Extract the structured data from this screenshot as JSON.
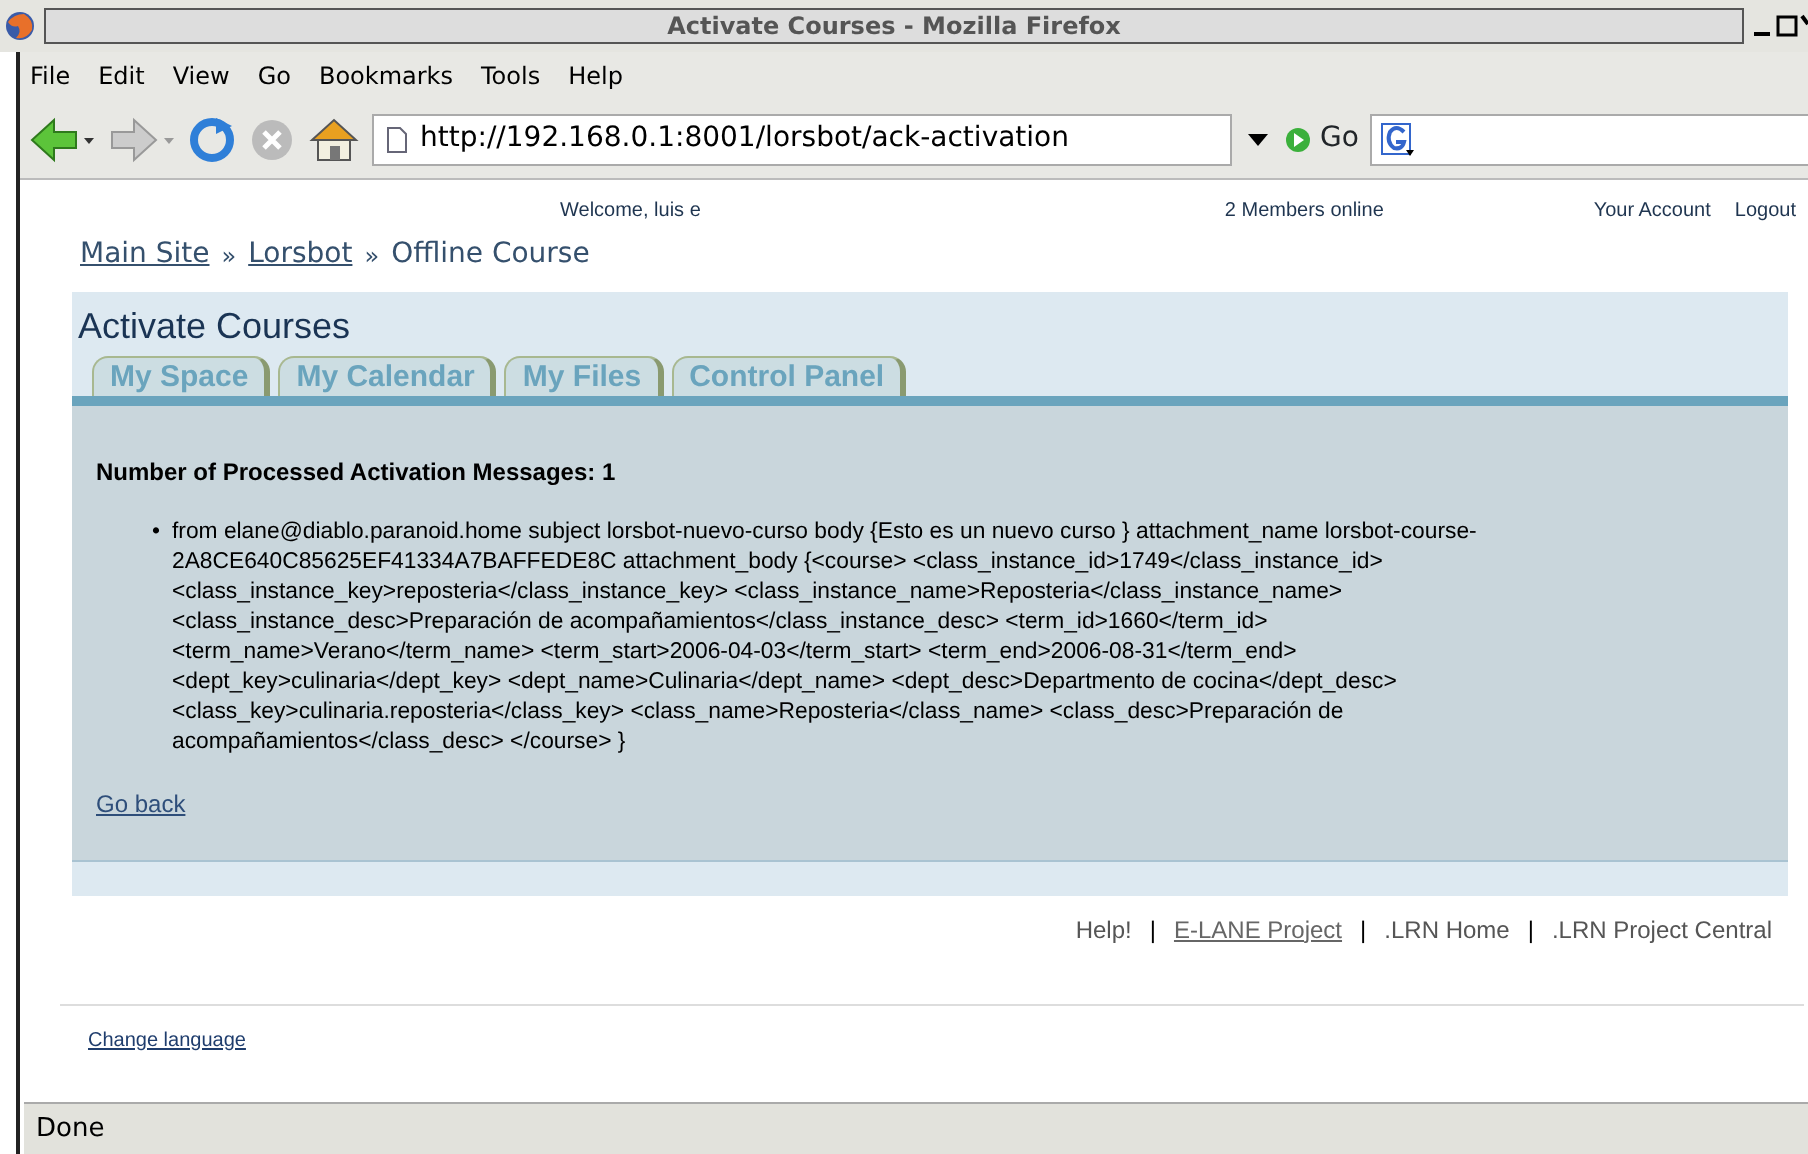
{
  "window": {
    "title": "Activate Courses - Mozilla Firefox"
  },
  "menu": [
    "File",
    "Edit",
    "View",
    "Go",
    "Bookmarks",
    "Tools",
    "Help"
  ],
  "toolbar": {
    "url": "http://192.168.0.1:8001/lorsbot/ack-activation",
    "go": "Go"
  },
  "header": {
    "welcome": "Welcome, luis e",
    "online": "2 Members online",
    "links": [
      "Your Account",
      "Logout"
    ]
  },
  "breadcrumb": [
    {
      "text": "Main Site",
      "kind": "link"
    },
    {
      "text": "»",
      "kind": "sep"
    },
    {
      "text": "Lorsbot",
      "kind": "link"
    },
    {
      "text": "»",
      "kind": "sep"
    },
    {
      "text": "Offline Course",
      "kind": "current"
    }
  ],
  "page_title": "Activate Courses",
  "tabs": [
    {
      "label": "My Space",
      "selected": false
    },
    {
      "label": "My Calendar",
      "selected": false
    },
    {
      "label": "My Files",
      "selected": false
    },
    {
      "label": "Control Panel",
      "selected": false
    }
  ],
  "heading": "Number of Processed Activation Messages: 1",
  "messages": [
    {
      "bullet": "•",
      "text": "from elane@diablo.paranoid.home subject lorsbot-nuevo-curso body {Esto es un nuevo curso } attachment_name lorsbot-course-2A8CE640C85625EF41334A7BAFFEDE8C attachment_body {<course> <class_instance_id>1749</class_instance_id> <class_instance_key>reposteria</class_instance_key> <class_instance_name>Reposteria</class_instance_name> <class_instance_desc>Preparación de acompañamientos</class_instance_desc> <term_id>1660</term_id> <term_name>Verano</term_name> <term_start>2006-04-03</term_start> <term_end>2006-08-31</term_end> <dept_key>culinaria</dept_key> <dept_name>Culinaria</dept_name> <dept_desc>Departmento de cocina</dept_desc> <class_key>culinaria.reposteria</class_key> <class_name>Reposteria</class_name> <class_desc>Preparación de acompañamientos</class_desc> </course> }"
    }
  ],
  "back_link": "Go back",
  "footer": [
    {
      "text": "Help!",
      "kind": "plain"
    },
    {
      "text": "|",
      "kind": "sep"
    },
    {
      "text": "E-LANE Project",
      "kind": "link"
    },
    {
      "text": "|",
      "kind": "sep"
    },
    {
      "text": ".LRN Home",
      "kind": "plain"
    },
    {
      "text": "|",
      "kind": "sep"
    },
    {
      "text": ".LRN Project Central",
      "kind": "plain"
    }
  ],
  "change_language": "Change language",
  "status_bar": "Done"
}
